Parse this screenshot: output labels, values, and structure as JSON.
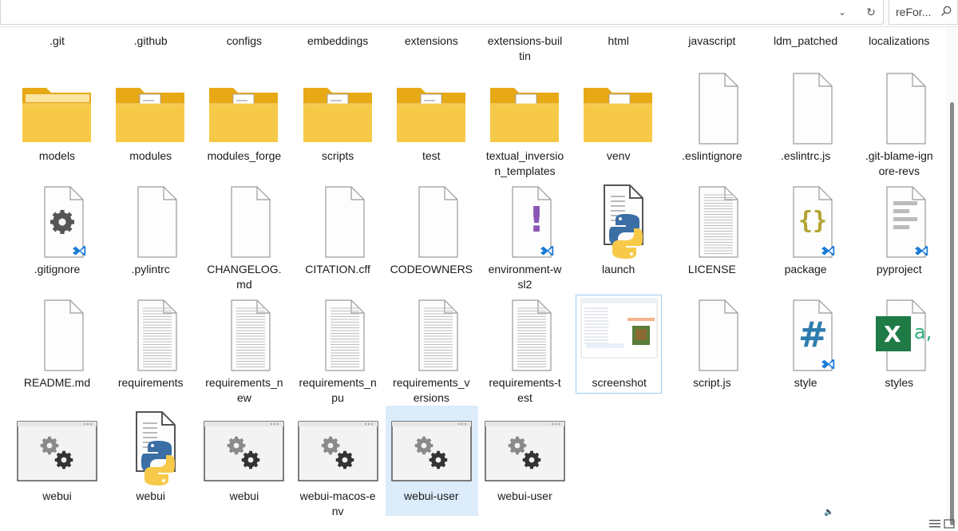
{
  "address_bar": {
    "search_text": "reFor..."
  },
  "row0_labels": [
    ".git",
    ".github",
    "configs",
    "embeddings",
    "extensions",
    "extensions-builtin",
    "html",
    "javascript",
    "ldm_patched",
    "localizations"
  ],
  "items": [
    {
      "label": "models",
      "icon": "folder-icon"
    },
    {
      "label": "modules",
      "icon": "folder-icon"
    },
    {
      "label": "modules_forge",
      "icon": "folder-icon"
    },
    {
      "label": "scripts",
      "icon": "folder-icon"
    },
    {
      "label": "test",
      "icon": "folder-icon"
    },
    {
      "label": "textual_inversion_templates",
      "icon": "folder-icon"
    },
    {
      "label": "venv",
      "icon": "folder-icon"
    },
    {
      "label": ".eslintignore",
      "icon": "file-icon"
    },
    {
      "label": ".eslintrc.js",
      "icon": "file-icon"
    },
    {
      "label": ".git-blame-ignore-revs",
      "icon": "file-icon"
    },
    {
      "label": ".gitignore",
      "icon": "gear-file-icon"
    },
    {
      "label": ".pylintrc",
      "icon": "file-icon"
    },
    {
      "label": "CHANGELOG.md",
      "icon": "file-icon"
    },
    {
      "label": "CITATION.cff",
      "icon": "file-icon"
    },
    {
      "label": "CODEOWNERS",
      "icon": "file-icon"
    },
    {
      "label": "environment-wsl2",
      "icon": "exclamation-file-icon"
    },
    {
      "label": "launch",
      "icon": "python-file-icon"
    },
    {
      "label": "LICENSE",
      "icon": "text-file-icon"
    },
    {
      "label": "package",
      "icon": "json-file-icon"
    },
    {
      "label": "pyproject",
      "icon": "lines-file-icon"
    },
    {
      "label": "README.md",
      "icon": "file-icon"
    },
    {
      "label": "requirements",
      "icon": "text-file-icon"
    },
    {
      "label": "requirements_new",
      "icon": "text-file-icon"
    },
    {
      "label": "requirements_npu",
      "icon": "text-file-icon"
    },
    {
      "label": "requirements_versions",
      "icon": "text-file-icon"
    },
    {
      "label": "requirements-test",
      "icon": "text-file-icon"
    },
    {
      "label": "screenshot",
      "icon": "image-thumbnail-icon"
    },
    {
      "label": "script.js",
      "icon": "file-icon"
    },
    {
      "label": "style",
      "icon": "hash-file-icon"
    },
    {
      "label": "styles",
      "icon": "excel-file-icon"
    },
    {
      "label": "webui",
      "icon": "batch-file-icon"
    },
    {
      "label": "webui",
      "icon": "python-file-icon"
    },
    {
      "label": "webui",
      "icon": "batch-file-icon"
    },
    {
      "label": "webui-macos-env",
      "icon": "batch-file-icon"
    },
    {
      "label": "webui-user",
      "icon": "batch-file-icon"
    },
    {
      "label": "webui-user",
      "icon": "batch-file-icon"
    }
  ],
  "label_lines": {
    "5": [
      "textual_inversio",
      "n_templates"
    ],
    "9": [
      ".git-blame-ign",
      "ore-revs"
    ],
    "12": [
      "CHANGELOG.",
      "md"
    ],
    "15": [
      "environment-w",
      "sl2"
    ],
    "22": [
      "requirements_n",
      "ew"
    ],
    "23": [
      "requirements_n",
      "pu"
    ],
    "24": [
      "requirements_v",
      "ersions"
    ],
    "25": [
      "requirements-t",
      "est"
    ],
    "33": [
      "webui-macos-e",
      "nv"
    ]
  },
  "row0_lines": {
    "5": [
      "extensions-buil",
      "tin"
    ]
  },
  "colors": {
    "folder": "#f7c948",
    "folder_dark": "#e8a917",
    "selection": "#dcecfb",
    "vscode_blue": "#1a7bd6"
  }
}
